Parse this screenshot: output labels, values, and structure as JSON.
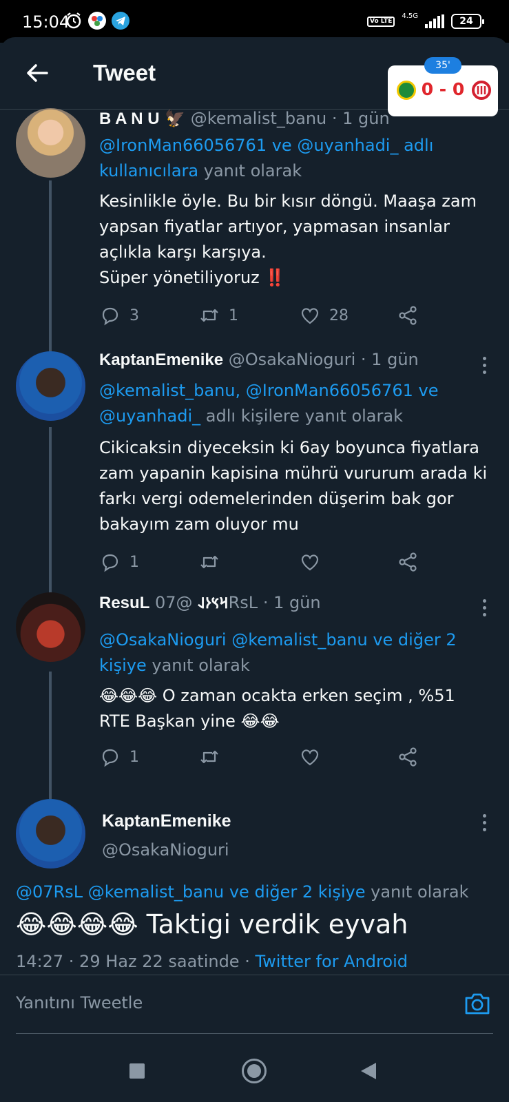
{
  "status_bar": {
    "time": "15:04",
    "network": "4.5G",
    "volte": "Vo LTE",
    "battery": "24"
  },
  "header": {
    "title": "Tweet"
  },
  "score_widget": {
    "minute": "35'",
    "score": "0 - 0",
    "home_color": "#1e8b3a",
    "away_color": "#d32030"
  },
  "replies": [
    {
      "name": "B A N U",
      "name_emoji": "🦅",
      "handle": "@kemalist_banu",
      "time": "· 1 gün",
      "reply_to_blue": "@IronMan66056761 ve @uyanhadi_ adlı kullanıcılara",
      "reply_to_suffix": "yanıt olarak",
      "body_lines": [
        "Kesinlikle öyle. Bu bir kısır döngü. Maaşa zam",
        "yapsan fiyatlar artıyor, yapmasan insanlar",
        "açlıkla karşı karşıya.",
        "Süper yönetiliyoruz ‼️"
      ],
      "replies_count": "3",
      "retweets_count": "1",
      "likes_count": "28"
    },
    {
      "name": "KaptanEmenike",
      "handle": "@OsakaNioguri",
      "time": "· 1 gün",
      "reply_to_blue_1": "@kemalist_banu, @IronMan66056761 ve",
      "reply_to_blue_2": "@uyanhadi_",
      "reply_to_suffix": "adlı kişilere yanıt olarak",
      "body_lines": [
        "Cikicaksin diyeceksin ki 6ay boyunca fiyatlara",
        "zam yapanin kapisina mührü vururum arada ki",
        "farkı vergi odemelerinden düşerim bak gor",
        "bakayım zam oluyor mu"
      ],
      "replies_count": "1"
    },
    {
      "name": "ResuL",
      "name_runes": "𐰺𐰽𐰆𐰞",
      "handle": "@07RsL",
      "time": "· 1 gün",
      "reply_to_blue_1": "@OsakaNioguri @kemalist_banu ve diğer 2",
      "reply_to_blue_2": "kişiye",
      "reply_to_suffix": "yanıt olarak",
      "body_lines": [
        "😂😂😂 O zaman ocakta erken seçim , %51",
        "RTE Başkan yine 😂😂"
      ],
      "replies_count": "1"
    }
  ],
  "main_tweet": {
    "name": "KaptanEmenike",
    "handle": "@OsakaNioguri",
    "reply_to_blue": "@07RsL @kemalist_banu ve diğer 2 kişiye",
    "reply_to_suffix": "yanıt olarak",
    "body": "😂😂😂😂 Taktigi verdik eyvah",
    "meta_time": "14:27 · 29 Haz 22 saatinde ·",
    "meta_source": "Twitter for Android"
  },
  "reply_bar": {
    "placeholder": "Yanıtını Tweetle"
  }
}
